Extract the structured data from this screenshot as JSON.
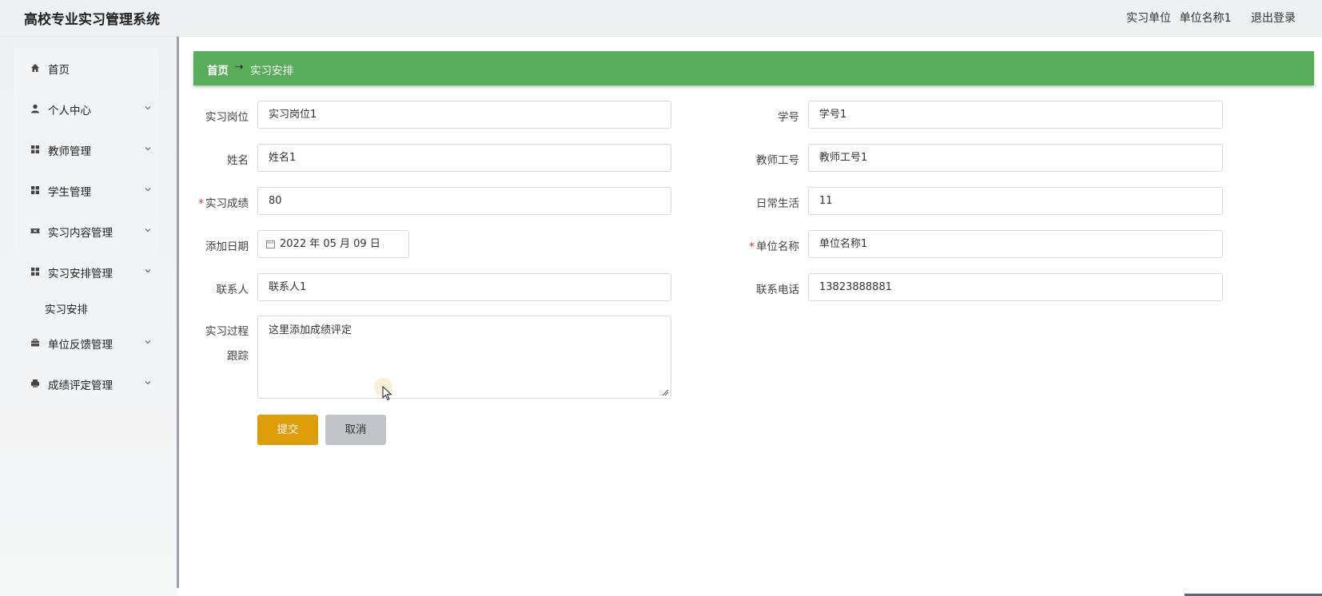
{
  "app": {
    "title": "高校专业实习管理系统"
  },
  "header": {
    "role": "实习单位",
    "username": "单位名称1",
    "logout": "退出登录"
  },
  "sidebar": {
    "items": [
      {
        "label": "首页",
        "icon": "home-icon"
      },
      {
        "label": "个人中心",
        "icon": "user-icon"
      },
      {
        "label": "教师管理",
        "icon": "grid-icon"
      },
      {
        "label": "学生管理",
        "icon": "grid-icon"
      },
      {
        "label": "实习内容管理",
        "icon": "ticket-icon"
      },
      {
        "label": "实习安排管理",
        "icon": "grid-icon"
      },
      {
        "label": "单位反馈管理",
        "icon": "briefcase-icon"
      },
      {
        "label": "成绩评定管理",
        "icon": "print-icon"
      }
    ],
    "sub_item": "实习安排"
  },
  "breadcrumb": {
    "home": "首页",
    "current": "实习安排"
  },
  "form": {
    "position": {
      "label": "实习岗位",
      "value": "实习岗位1"
    },
    "student_no": {
      "label": "学号",
      "value": "学号1"
    },
    "name": {
      "label": "姓名",
      "value": "姓名1"
    },
    "teacher_no": {
      "label": "教师工号",
      "value": "教师工号1"
    },
    "score": {
      "label": "实习成绩",
      "value": "80",
      "required": "*"
    },
    "daily_life": {
      "label": "日常生活",
      "value": "11"
    },
    "add_date": {
      "label": "添加日期",
      "value": "2022 年 05 月 09 日"
    },
    "company_name": {
      "label": "单位名称",
      "value": "单位名称1",
      "required": "*"
    },
    "contact": {
      "label": "联系人",
      "value": "联系人1"
    },
    "phone": {
      "label": "联系电话",
      "value": "13823888881"
    },
    "tracking": {
      "label_line1": "实习过程",
      "label_line2": "跟踪",
      "value": "这里添加成绩评定"
    }
  },
  "buttons": {
    "submit": "提交",
    "cancel": "取消"
  },
  "colors": {
    "accent_green": "#57ad59",
    "submit_orange": "#de9d06",
    "cancel_gray": "#c1c5c9",
    "required_red": "#d33"
  }
}
